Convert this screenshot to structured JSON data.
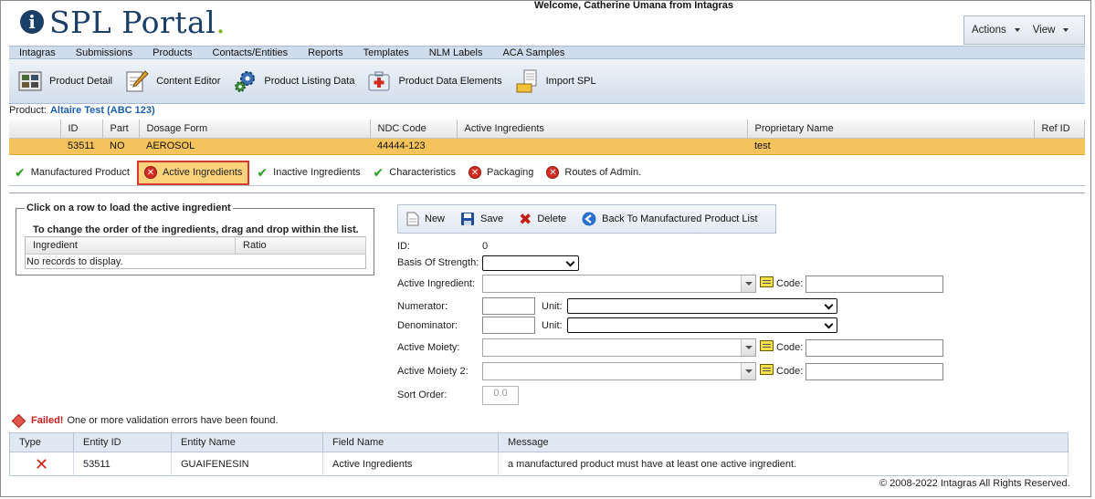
{
  "header": {
    "app_name": "SPL Portal",
    "logo_letter": "i",
    "logo_dot": ".",
    "welcome": "Welcome, Catherine Umana from Intagras",
    "actions_label": "Actions",
    "view_label": "View"
  },
  "menu": [
    "Intagras",
    "Submissions",
    "Products",
    "Contacts/Entities",
    "Reports",
    "Templates",
    "NLM Labels",
    "ACA Samples"
  ],
  "toolbar": {
    "product_detail": "Product Detail",
    "content_editor": "Content Editor",
    "product_listing_data": "Product Listing Data",
    "product_data_elements": "Product Data Elements",
    "import_spl": "Import SPL"
  },
  "product": {
    "label": "Product:",
    "name": "Altaire Test (ABC 123)",
    "columns": [
      "ID",
      "Part",
      "Dosage Form",
      "NDC Code",
      "Active Ingredients",
      "Proprietary Name",
      "Ref ID"
    ],
    "row": [
      "53511",
      "NO",
      "AEROSOL",
      "44444-123",
      "",
      "test",
      ""
    ]
  },
  "tabs": [
    {
      "label": "Manufactured Product",
      "status": "ok"
    },
    {
      "label": "Active Ingredients",
      "status": "error"
    },
    {
      "label": "Inactive Ingredients",
      "status": "ok"
    },
    {
      "label": "Characteristics",
      "status": "ok"
    },
    {
      "label": "Packaging",
      "status": "error"
    },
    {
      "label": "Routes of Admin.",
      "status": "error"
    }
  ],
  "ingredients_panel": {
    "legend": "Click on a row to load the active ingredient",
    "instruction": "To change the order of the ingredients, drag and drop within the list.",
    "columns": [
      "Ingredient",
      "Ratio"
    ],
    "empty": "No records to display."
  },
  "form": {
    "buttons": {
      "new": "New",
      "save": "Save",
      "delete": "Delete",
      "back": "Back To Manufactured Product List"
    },
    "id_label": "ID:",
    "id_value": "0",
    "basis_label": "Basis Of Strength:",
    "active_ingredient_label": "Active Ingredient:",
    "code_label": "Code:",
    "numerator_label": "Numerator:",
    "denominator_label": "Denominator:",
    "unit_label": "Unit:",
    "moiety_label": "Active Moiety:",
    "moiety2_label": "Active Moiety 2:",
    "sort_label": "Sort Order:",
    "sort_placeholder": "0.0"
  },
  "validation": {
    "failed": "Failed!",
    "message": "One or more validation errors have been found.",
    "columns": [
      "Type",
      "Entity ID",
      "Entity Name",
      "Field Name",
      "Message"
    ],
    "rows": [
      {
        "entity_id": "53511",
        "entity_name": "GUAIFENESIN",
        "field": "Active Ingredients",
        "message": "a manufactured product must have at least one active ingredient."
      }
    ]
  },
  "footer": "© 2008-2022 Intagras All Rights Reserved.",
  "colors": {
    "brand": "#1b3f66",
    "accent_green": "#7cb51c",
    "selected_row": "#f5c35b",
    "error": "#d52b22",
    "ok": "#23a018"
  }
}
